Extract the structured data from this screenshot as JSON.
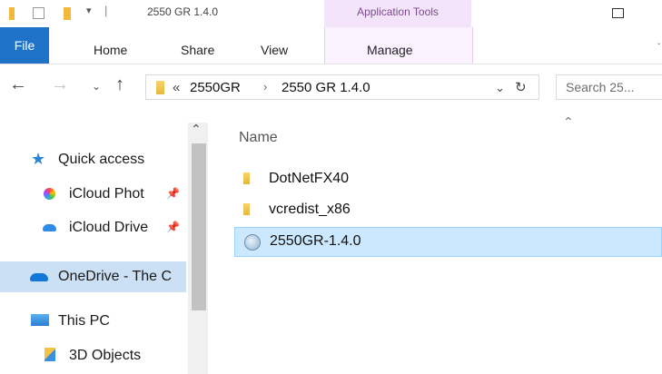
{
  "titlebar": {
    "title": "2550 GR 1.4.0",
    "context_tab": "Application Tools"
  },
  "ribbon": {
    "tabs": [
      "File",
      "Home",
      "Share",
      "View",
      "Manage"
    ]
  },
  "address": {
    "overflow": "«",
    "crumbs": [
      "2550GR",
      "2550 GR 1.4.0"
    ],
    "search_placeholder": "Search 25..."
  },
  "nav": {
    "items": [
      {
        "label": "Quick access",
        "icon": "star-icon"
      },
      {
        "label": "iCloud Phot",
        "icon": "icloud-photos-icon"
      },
      {
        "label": "iCloud Drive",
        "icon": "icloud-drive-icon"
      },
      {
        "label": "OneDrive - The C",
        "icon": "onedrive-icon"
      },
      {
        "label": "This PC",
        "icon": "pc-icon"
      },
      {
        "label": "3D Objects",
        "icon": "3d-objects-icon"
      }
    ]
  },
  "content": {
    "column_name": "Name",
    "files": [
      {
        "name": "DotNetFX40",
        "icon": "folder-icon"
      },
      {
        "name": "vcredist_x86",
        "icon": "folder-icon"
      },
      {
        "name": "2550GR-1.4.0",
        "icon": "installer-icon"
      }
    ]
  },
  "colors": {
    "file_tab": "#1e73c9",
    "context_tab": "#f4e4fb",
    "selection": "#cce8ff"
  }
}
